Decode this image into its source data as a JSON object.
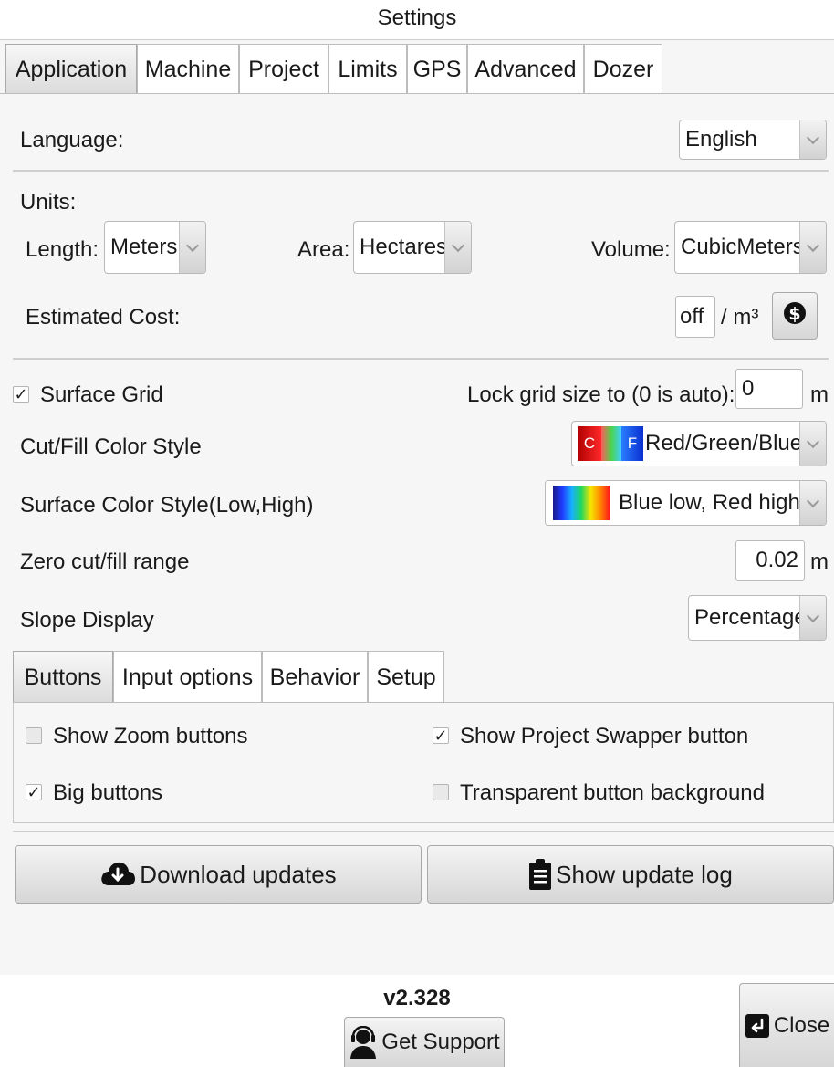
{
  "window": {
    "title": "Settings"
  },
  "tabs": [
    "Application",
    "Machine",
    "Project",
    "Limits",
    "GPS",
    "Advanced",
    "Dozer"
  ],
  "language": {
    "label": "Language:",
    "value": "English"
  },
  "units": {
    "heading": "Units:",
    "length_label": "Length:",
    "length_value": "Meters",
    "area_label": "Area:",
    "area_value": "Hectares",
    "volume_label": "Volume:",
    "volume_value": "CubicMeters"
  },
  "cost": {
    "label": "Estimated Cost:",
    "value": "off",
    "unit": "/ m³"
  },
  "surface_grid": {
    "label": "Surface Grid",
    "checked": true
  },
  "lock_grid": {
    "label": "Lock grid size to (0 is auto):",
    "value": "0",
    "unit": "m"
  },
  "cutfill_style": {
    "label": "Cut/Fill Color Style",
    "value": "Red/Green/Blue",
    "c_letter": "C",
    "f_letter": "F"
  },
  "surface_style": {
    "label": "Surface Color Style(Low,High)",
    "value": "Blue low, Red high"
  },
  "zero_range": {
    "label": "Zero cut/fill range",
    "value": "0.02",
    "unit": "m"
  },
  "slope": {
    "label": "Slope Display",
    "value": "Percentage"
  },
  "subtabs": [
    "Buttons",
    "Input options",
    "Behavior",
    "Setup"
  ],
  "buttons_options": {
    "show_zoom": {
      "label": "Show Zoom buttons",
      "checked": false
    },
    "show_swapper": {
      "label": "Show Project Swapper button",
      "checked": true
    },
    "big_buttons": {
      "label": "Big buttons",
      "checked": true
    },
    "transparent_bg": {
      "label": "Transparent button background",
      "checked": false
    }
  },
  "actions": {
    "download": "Download updates",
    "update_log": "Show update log"
  },
  "footer": {
    "version": "v2.328",
    "support": "Get Support",
    "close": "Close"
  },
  "check_glyph": "✓",
  "icons": [
    "cloud-download-icon",
    "clipboard-list-icon",
    "support-agent-icon",
    "exit-icon",
    "currency-icon",
    "chevron-down-icon"
  ]
}
